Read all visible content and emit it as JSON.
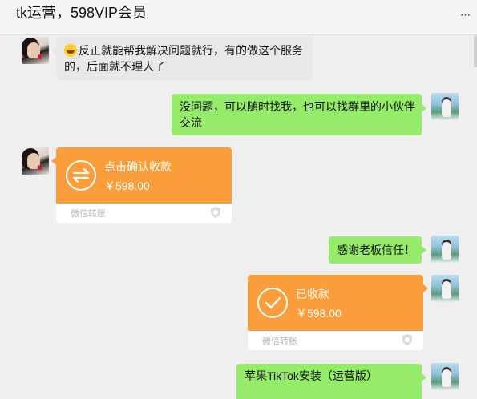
{
  "header": {
    "title": "tk运营，598VIP会员",
    "more_icon": "ellipsis-icon"
  },
  "messages": [
    {
      "side": "left",
      "type": "text",
      "lines": [
        "反正就能帮我解决问题就行，有的做这个服务",
        "的，后面就不理人了"
      ],
      "emoji": "grin-sweat-emoji"
    },
    {
      "side": "right",
      "type": "text",
      "lines": [
        "没问题，可以随时找我，也可以找群里的小伙伴",
        "交流"
      ]
    },
    {
      "side": "left",
      "type": "transfer",
      "label": "点击确认收款",
      "amount": "￥598.00",
      "footer": "微信转账",
      "icon": "transfer-arrows-icon"
    },
    {
      "side": "right",
      "type": "text",
      "lines": [
        "感谢老板信任！"
      ]
    },
    {
      "side": "right",
      "type": "transfer",
      "label": "已收款",
      "amount": "￥598.00",
      "footer": "微信转账",
      "icon": "check-circle-icon"
    },
    {
      "side": "right",
      "type": "text",
      "lines": [
        "苹果TikTok安装（运营版）"
      ]
    }
  ],
  "colors": {
    "chat_bg": "#efefef",
    "green_bubble": "#95ec69",
    "gray_bubble": "#e8e8e8",
    "transfer_orange": "#fa9d3b"
  }
}
